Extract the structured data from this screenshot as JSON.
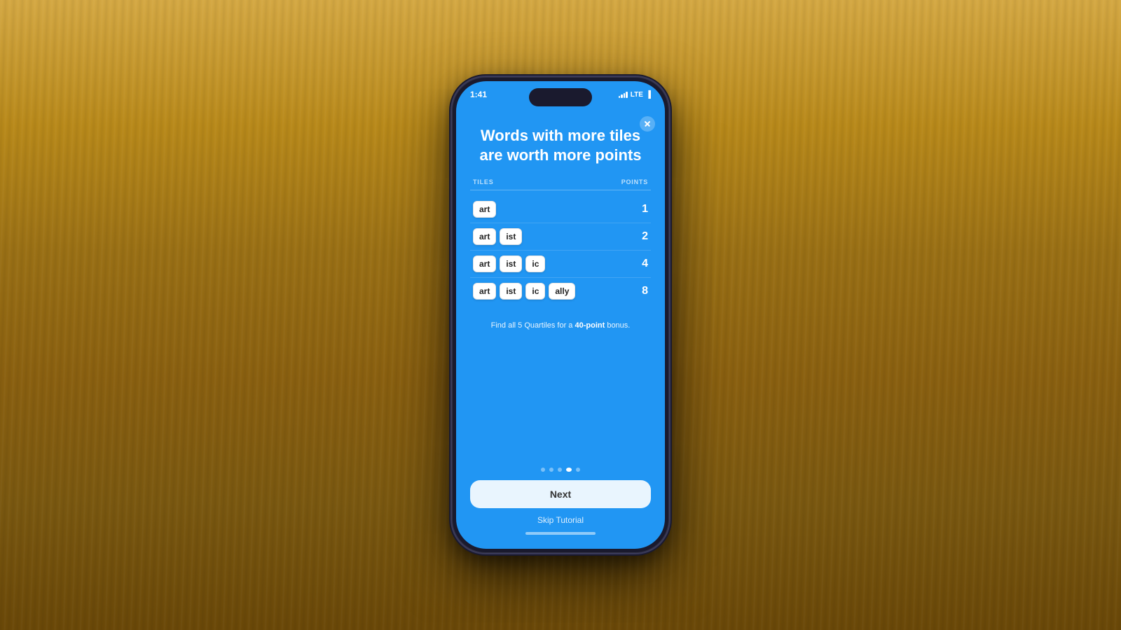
{
  "background": {
    "color": "#b8891a"
  },
  "phone": {
    "status_bar": {
      "time": "1:41",
      "bell_icon": "bell-icon",
      "signal_icon": "signal-icon",
      "lte_label": "LTE",
      "battery_icon": "battery-icon"
    },
    "close_button_label": "×",
    "screen": {
      "headline": "Words with more tiles are worth more points",
      "table": {
        "header_tiles": "TILES",
        "header_points": "POINTS",
        "rows": [
          {
            "tiles": [
              "art"
            ],
            "points": "1"
          },
          {
            "tiles": [
              "art",
              "ist"
            ],
            "points": "2"
          },
          {
            "tiles": [
              "art",
              "ist",
              "ic"
            ],
            "points": "4"
          },
          {
            "tiles": [
              "art",
              "ist",
              "ic",
              "ally"
            ],
            "points": "8"
          }
        ]
      },
      "bonus_text_prefix": "Find all 5 Quartiles for a ",
      "bonus_highlight": "40-point",
      "bonus_text_suffix": " bonus.",
      "dots": [
        {
          "active": false
        },
        {
          "active": false
        },
        {
          "active": false
        },
        {
          "active": true
        },
        {
          "active": false
        }
      ],
      "next_button": "Next",
      "skip_button": "Skip Tutorial"
    }
  }
}
